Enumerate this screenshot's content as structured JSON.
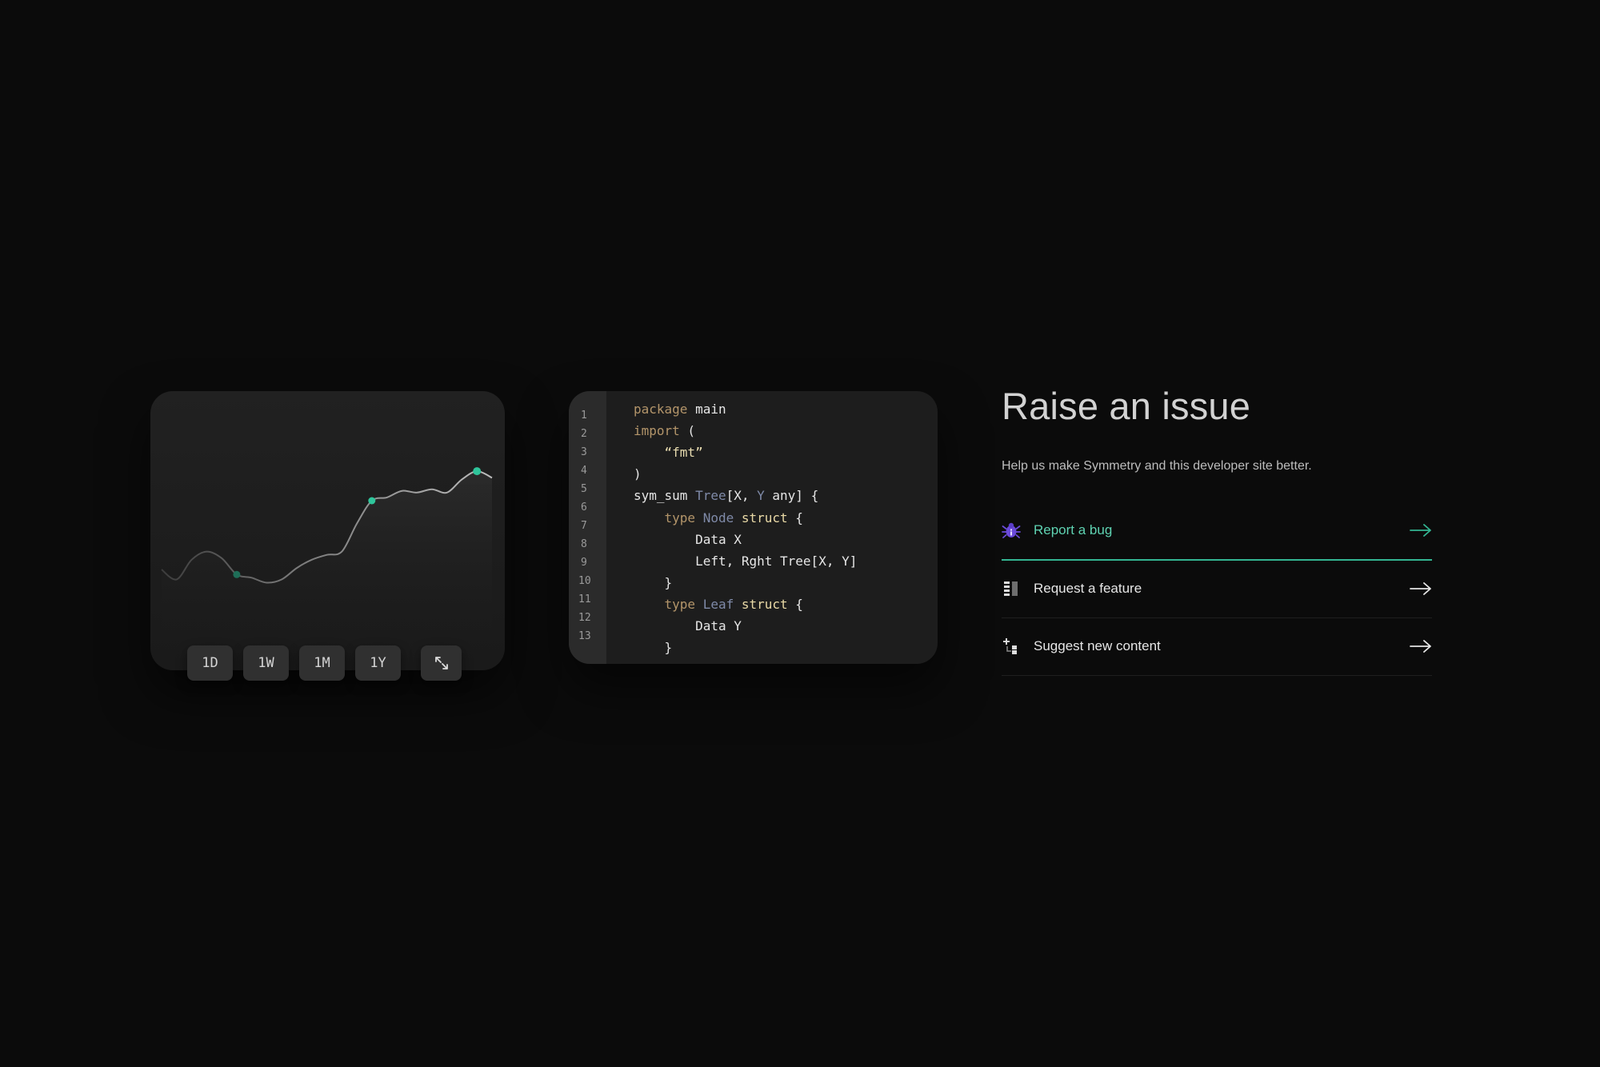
{
  "chart": {
    "ranges": [
      "1D",
      "1W",
      "1M",
      "1Y"
    ],
    "expand_icon": "expand-arrows-icon",
    "accent_color": "#2fc59b",
    "line_series": [
      18,
      12,
      24,
      29,
      25,
      15,
      13,
      10,
      12,
      19,
      24,
      27,
      29,
      46,
      60,
      62,
      66,
      65,
      67,
      65,
      73,
      78,
      74
    ]
  },
  "code": {
    "line_numbers": [
      "1",
      "2",
      "3",
      "4",
      "5",
      "6",
      "7",
      "8",
      "9",
      "10",
      "11",
      "12",
      "13"
    ],
    "lines": [
      [
        {
          "t": "package",
          "c": "kw"
        },
        {
          "t": " main",
          "c": ""
        }
      ],
      [
        {
          "t": "import",
          "c": "kw"
        },
        {
          "t": " (",
          "c": ""
        }
      ],
      [
        {
          "t": "    ",
          "c": ""
        },
        {
          "t": "“fmt”",
          "c": "str"
        }
      ],
      [
        {
          "t": ")",
          "c": ""
        }
      ],
      [
        {
          "t": "sym_sum ",
          "c": ""
        },
        {
          "t": "Tree",
          "c": "ty"
        },
        {
          "t": "[X, ",
          "c": ""
        },
        {
          "t": "Y",
          "c": "ty"
        },
        {
          "t": " any] {",
          "c": ""
        }
      ],
      [
        {
          "t": "    ",
          "c": ""
        },
        {
          "t": "type",
          "c": "kw"
        },
        {
          "t": " ",
          "c": ""
        },
        {
          "t": "Node",
          "c": "ty"
        },
        {
          "t": " ",
          "c": ""
        },
        {
          "t": "struct",
          "c": "st"
        },
        {
          "t": " {",
          "c": ""
        }
      ],
      [
        {
          "t": "        Data X",
          "c": ""
        }
      ],
      [
        {
          "t": "        Left, Rght Tree[X, Y]",
          "c": ""
        }
      ],
      [
        {
          "t": "    }",
          "c": ""
        }
      ],
      [
        {
          "t": "    ",
          "c": ""
        },
        {
          "t": "type",
          "c": "kw"
        },
        {
          "t": " ",
          "c": ""
        },
        {
          "t": "Leaf",
          "c": "ty"
        },
        {
          "t": " ",
          "c": ""
        },
        {
          "t": "struct",
          "c": "st"
        },
        {
          "t": " {",
          "c": ""
        }
      ],
      [
        {
          "t": "        Data Y",
          "c": ""
        }
      ],
      [
        {
          "t": "    }",
          "c": ""
        }
      ]
    ]
  },
  "issue": {
    "title": "Raise an issue",
    "subtitle": "Help us make Symmetry and this developer site better.",
    "items": [
      {
        "label": "Report a bug",
        "icon": "bug-icon",
        "active": true
      },
      {
        "label": "Request a feature",
        "icon": "feature-list-icon",
        "active": false
      },
      {
        "label": "Suggest new content",
        "icon": "add-content-icon",
        "active": false
      }
    ],
    "arrow_icon": "arrow-right-icon",
    "accent_color": "#33b592"
  }
}
